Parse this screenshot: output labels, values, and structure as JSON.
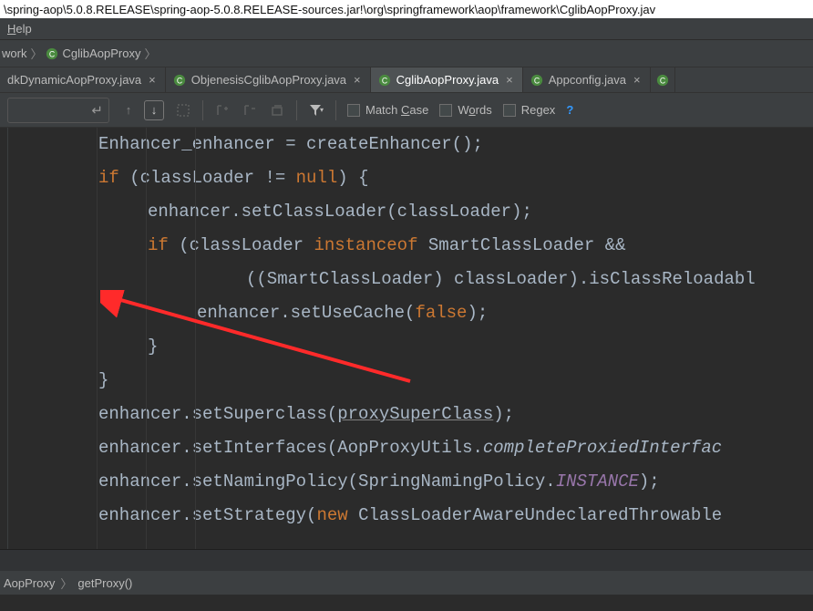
{
  "path_bar": "\\spring-aop\\5.0.8.RELEASE\\spring-aop-5.0.8.RELEASE-sources.jar!\\org\\springframework\\aop\\framework\\CglibAopProxy.jav",
  "menu": {
    "help": "Help"
  },
  "breadcrumb": {
    "crumb1": "work",
    "crumb2": "CglibAopProxy"
  },
  "tabs": [
    {
      "label": "dkDynamicAopProxy.java",
      "active": false
    },
    {
      "label": "ObjenesisCglibAopProxy.java",
      "active": false
    },
    {
      "label": "CglibAopProxy.java",
      "active": true
    },
    {
      "label": "Appconfig.java",
      "active": false
    }
  ],
  "searchbar": {
    "match_case": "Match Case",
    "words": "Words",
    "regex": "Regex"
  },
  "code": {
    "l1a": "Enhancer_enhancer = createEnhancer();",
    "l2_if": "if",
    "l2_rest": " (classLoader != ",
    "l2_null": "null",
    "l2_end": ") {",
    "l3": "enhancer.setClassLoader(classLoader);",
    "l4_if": "if",
    "l4_rest": " (classLoader ",
    "l4_inst": "instanceof",
    "l4_end": " SmartClassLoader &&",
    "l5": "((SmartClassLoader) classLoader).isClassReloadabl",
    "l6a": "enhancer.setUseCache(",
    "l6_false": "false",
    "l6b": ");",
    "l7": "}",
    "l8": "}",
    "l9a": "enhancer.setSuperclass(",
    "l9b": "proxySuperClass",
    "l9c": ");",
    "l10a": "enhancer.setInterfaces(AopProxyUtils.",
    "l10b": "completeProxiedInterfac",
    "l11a": "enhancer.setNamingPolicy(SpringNamingPolicy.",
    "l11b": "INSTANCE",
    "l11c": ");",
    "l12a": "enhancer.setStrategy(",
    "l12_new": "new",
    "l12b": " ClassLoaderAwareUndeclaredThrowable"
  },
  "bottom": {
    "crumb1": "AopProxy",
    "crumb2": "getProxy()"
  }
}
